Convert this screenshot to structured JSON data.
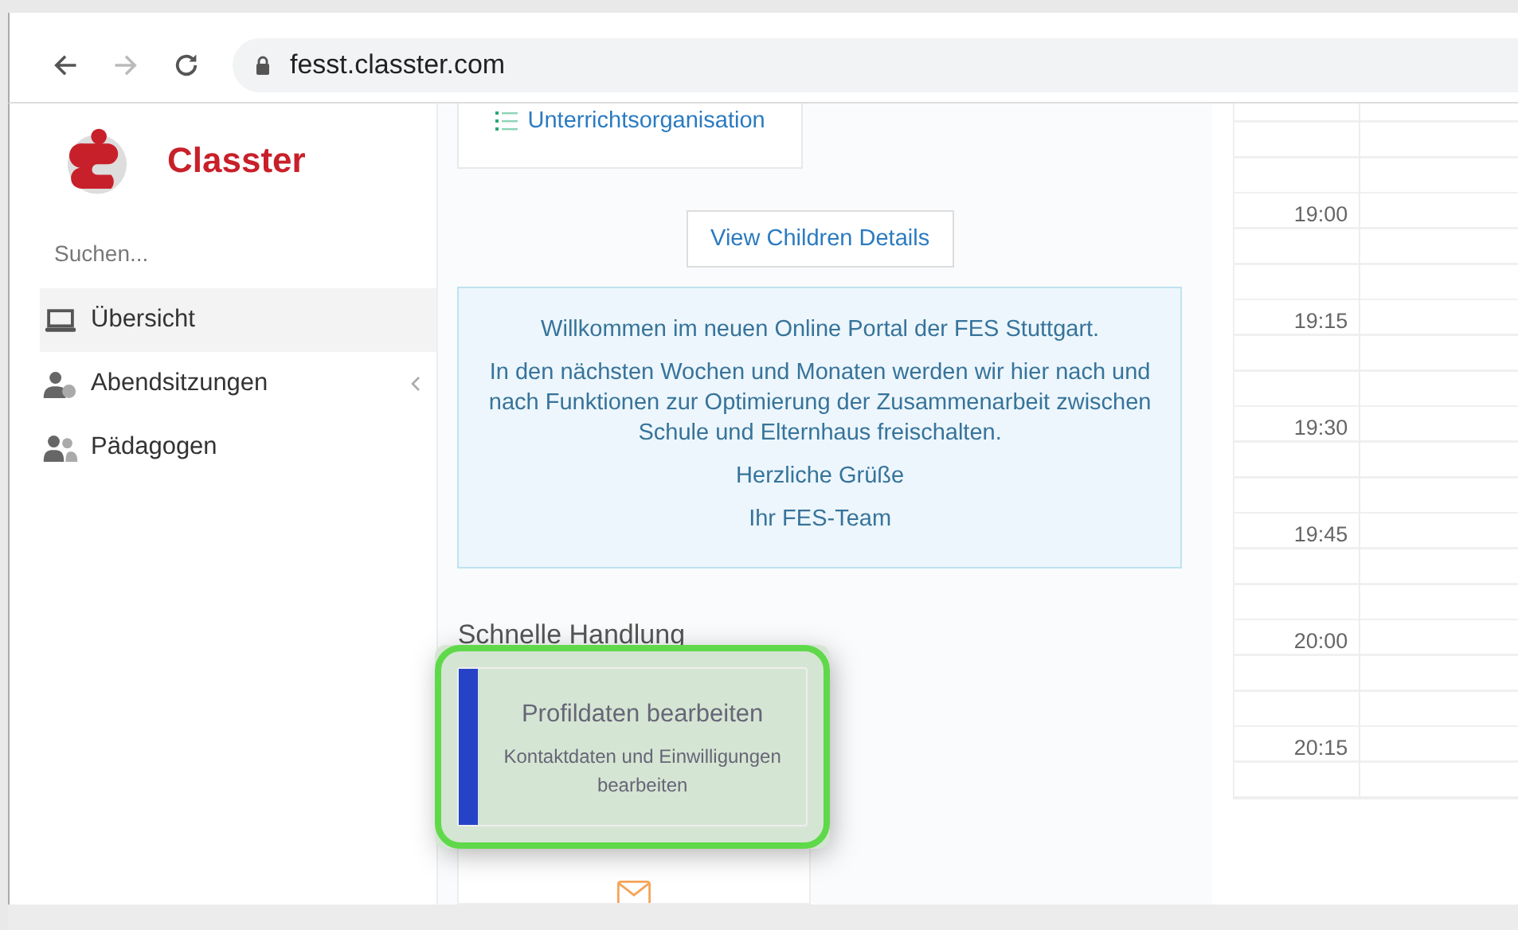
{
  "browser": {
    "url": "fesst.classter.com"
  },
  "sidebar": {
    "brand": "Classter",
    "search": {
      "placeholder": "Suchen..."
    },
    "items": [
      {
        "label": "Übersicht",
        "selected": true,
        "expandable": false
      },
      {
        "label": "Abendsitzungen",
        "selected": false,
        "expandable": true
      },
      {
        "label": "Pädagogen",
        "selected": false,
        "expandable": false
      }
    ]
  },
  "main": {
    "top_card": {
      "link": "Unterrichtsorganisation"
    },
    "children_button": "View Children Details",
    "welcome": [
      "Willkommen im neuen Online Portal der FES Stuttgart.",
      "In den nächsten Wochen und Monaten werden wir hier nach und nach Funktionen zur Optimierung der Zusammenarbeit zwischen Schule und Elternhaus freischalten.",
      "Herzliche Grüße",
      "Ihr FES-Team"
    ],
    "quick_actions": {
      "title": "Schnelle Handlung",
      "cards": [
        {
          "kind": "action",
          "title": "Profildaten bearbeiten",
          "subtitle": "Kontaktdaten und Einwilligungen bearbeiten",
          "highlighted": true
        },
        {
          "kind": "mail",
          "highlighted": false
        }
      ]
    }
  },
  "calendar": {
    "times": [
      "19:00",
      "19:15",
      "19:30",
      "19:45",
      "20:00",
      "20:15"
    ]
  }
}
